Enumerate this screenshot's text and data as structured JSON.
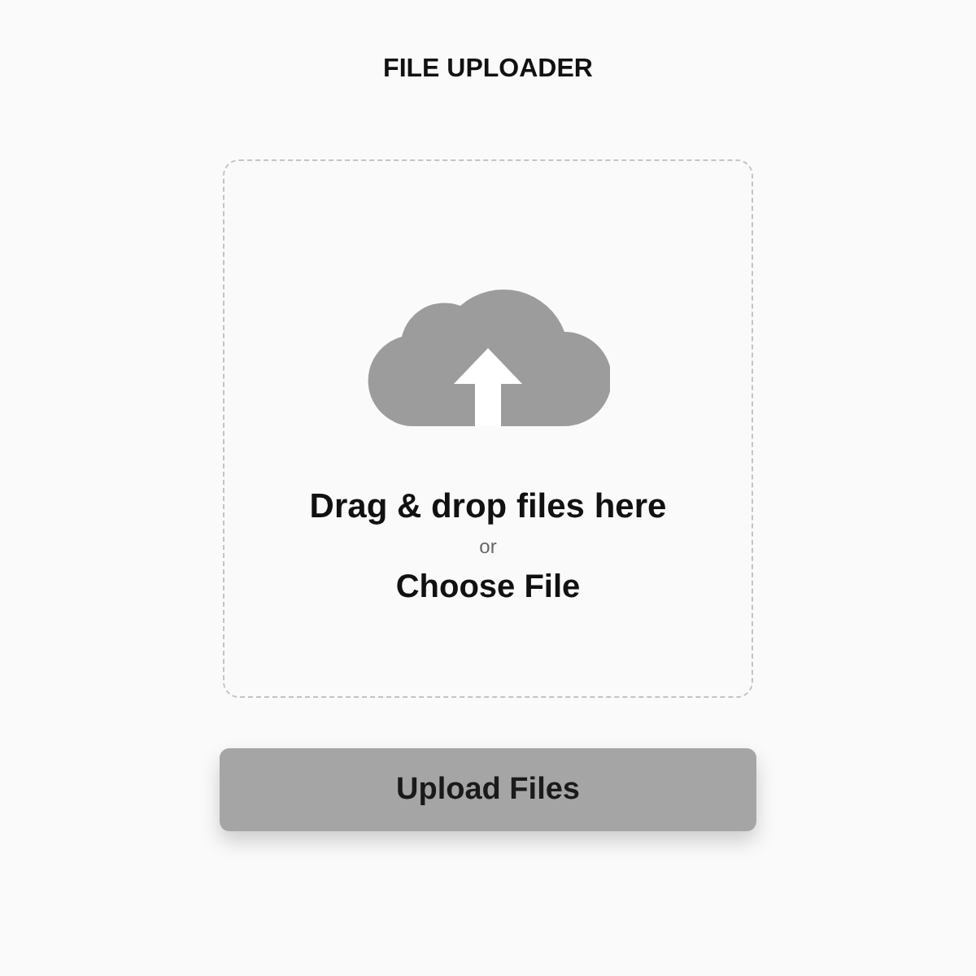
{
  "title": "FILE UPLOADER",
  "dropzone": {
    "prompt": "Drag & drop files here",
    "separator": "or",
    "choose_link": "Choose File"
  },
  "upload_button": {
    "label": "Upload Files"
  }
}
